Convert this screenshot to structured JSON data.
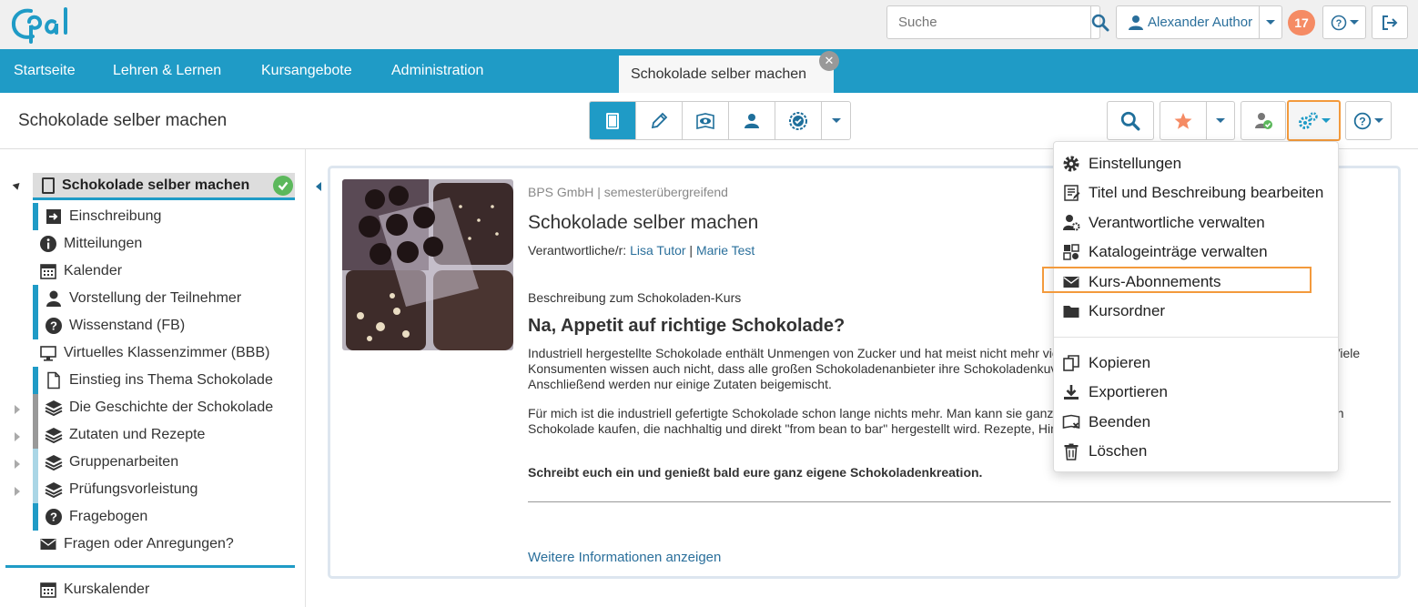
{
  "header": {
    "logo_text": "Opal",
    "search_placeholder": "Suche",
    "user_name": "Alexander Author",
    "notification_count": "17"
  },
  "nav": {
    "items": [
      "Startseite",
      "Lehren & Lernen",
      "Kursangebote",
      "Administration"
    ],
    "active_tab": "Schokolade selber machen"
  },
  "course": {
    "title": "Schokolade selber machen"
  },
  "sidebar": {
    "root": "Schokolade selber machen",
    "items": [
      {
        "label": "Einschreibung",
        "icon": "enroll-icon"
      },
      {
        "label": "Mitteilungen",
        "icon": "info-icon"
      },
      {
        "label": "Kalender",
        "icon": "calendar-icon"
      },
      {
        "label": "Vorstellung der Teilnehmer",
        "icon": "user-icon"
      },
      {
        "label": "Wissenstand (FB)",
        "icon": "question-icon"
      },
      {
        "label": "Virtuelles Klassenzimmer (BBB)",
        "icon": "monitor-icon"
      },
      {
        "label": "Einstieg ins Thema Schokolade",
        "icon": "document-icon"
      },
      {
        "label": "Die Geschichte der Schokolade",
        "icon": "layers-icon"
      },
      {
        "label": "Zutaten und Rezepte",
        "icon": "layers-icon"
      },
      {
        "label": "Gruppenarbeiten",
        "icon": "layers-icon"
      },
      {
        "label": "Prüfungsvorleistung",
        "icon": "layers-icon"
      },
      {
        "label": "Fragebogen",
        "icon": "question-icon"
      },
      {
        "label": "Fragen oder Anregungen?",
        "icon": "envelope-icon"
      }
    ],
    "calendar": "Kurskalender"
  },
  "main": {
    "org": "BPS GmbH | semesterübergreifend",
    "title": "Schokolade selber machen",
    "responsible_label": "Verantwortliche/r:",
    "responsible_1": "Lisa Tutor",
    "responsible_2": "Marie Test",
    "desc_label": "Beschreibung zum Schokoladen-Kurs",
    "heading": "Na, Appetit auf richtige Schokolade?",
    "p1": "Industriell hergestellte Schokolade enthält Unmengen von Zucker und hat meist nicht mehr viel mit dem eigentlichen Kakaogeschmack zu tun. Viele Konsumenten wissen auch nicht, dass alle großen Schokoladenanbieter ihre Schokoladenkuvertüre von einem von 4 Herstellern einkaufen. Anschließend werden nur einige Zutaten beigemischt.",
    "p2": "Für mich ist die industriell gefertigte Schokolade schon lange nichts mehr. Man kann sie ganz einfach selbst herstellen. Alternativ kann man auch Schokolade kaufen, die nachhaltig und direkt \"from bean to bar\" hergestellt wird. Rezepte, Hintergründe und Anleitungen gibt es hier im Kurs.",
    "p3": "Schreibt euch ein und genießt bald eure ganz eigene Schokoladenkreation.",
    "more": "Weitere Informationen anzeigen"
  },
  "menu": {
    "items": [
      {
        "label": "Einstellungen",
        "icon": "gear-icon"
      },
      {
        "label": "Titel und Beschreibung bearbeiten",
        "icon": "edit-text-icon"
      },
      {
        "label": "Verantwortliche verwalten",
        "icon": "user-gear-icon"
      },
      {
        "label": "Katalogeinträge verwalten",
        "icon": "catalog-icon"
      },
      {
        "label": "Kurs-Abonnements",
        "icon": "envelope-icon"
      },
      {
        "label": "Kursordner",
        "icon": "folder-icon"
      },
      {
        "label": "Kopieren",
        "icon": "copy-icon"
      },
      {
        "label": "Exportieren",
        "icon": "download-icon"
      },
      {
        "label": "Beenden",
        "icon": "book-close-icon"
      },
      {
        "label": "Löschen",
        "icon": "trash-icon"
      }
    ]
  },
  "colors": {
    "brand": "#1f9bc6",
    "highlight": "#f39a3c",
    "badge": "#f58b64",
    "link": "#2a6f9b"
  }
}
